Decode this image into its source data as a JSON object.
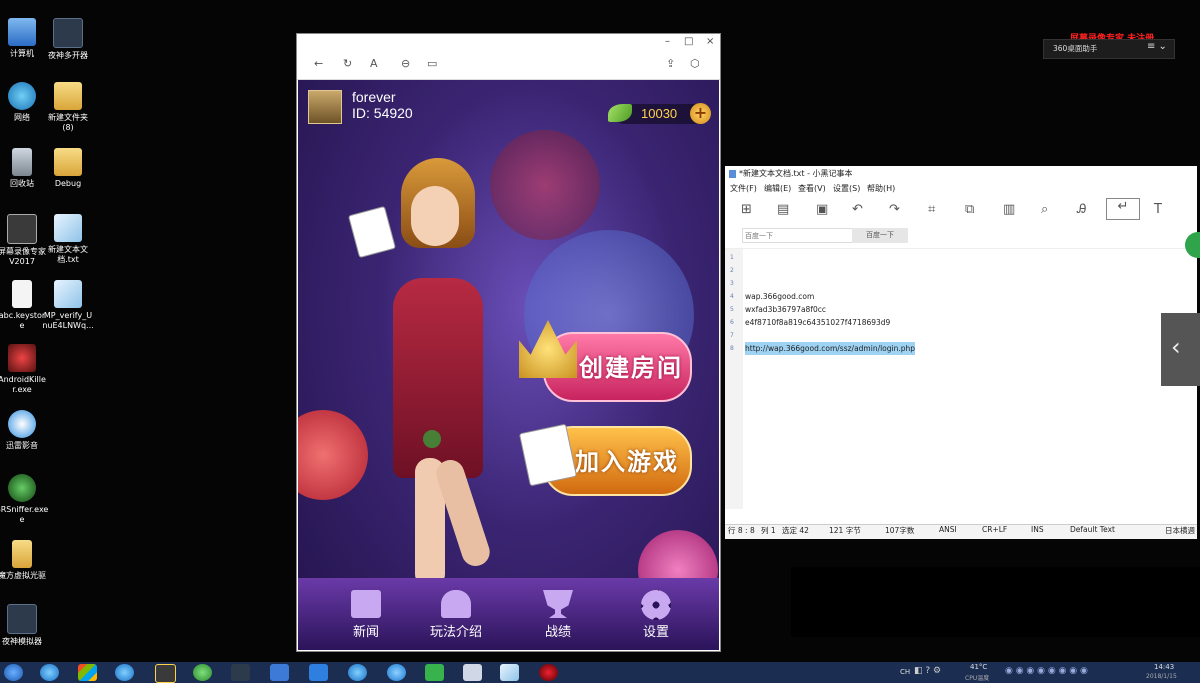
{
  "desktop": {
    "icons": [
      {
        "label": "计算机"
      },
      {
        "label": "夜神多开器"
      },
      {
        "label": "网络"
      },
      {
        "label": "新建文件夹\n(8)"
      },
      {
        "label": "回收站"
      },
      {
        "label": "Debug"
      },
      {
        "label": "屏幕录像专家\nV2017"
      },
      {
        "label": "新建文本文\n档.txt"
      },
      {
        "label": "abc.keystor\ne"
      },
      {
        "label": "MP_verify_U\nnuE4LNWq..."
      },
      {
        "label": "AndroidKille\nr.exe"
      },
      {
        "label": "迅雷影音"
      },
      {
        "label": "SRSniffer.exe\ne"
      },
      {
        "label": "魔方虚拟光驱"
      },
      {
        "label": "夜神模拟器"
      }
    ],
    "watermark": "屏幕录像专家 未注册",
    "assistant_label": "360桌面助手"
  },
  "browser": {
    "controls": {
      "minimize": "–",
      "maximize": "□",
      "close": "×"
    },
    "toolbar": {
      "back": "←",
      "refresh": "↻",
      "font": "A",
      "link": "⊖",
      "card": "▭",
      "share": "⇪",
      "cube": "⬡"
    }
  },
  "game": {
    "username": "forever",
    "user_id": "ID: 54920",
    "coins": "10030",
    "create_room": "创建房间",
    "join_game": "加入游戏",
    "nav": [
      {
        "label": "新闻",
        "icon": "calendar-icon"
      },
      {
        "label": "玩法介绍",
        "icon": "help-person-icon"
      },
      {
        "label": "战绩",
        "icon": "trophy-icon"
      },
      {
        "label": "设置",
        "icon": "gear-icon"
      }
    ]
  },
  "notepad": {
    "title": "*新建文本文档.txt - 小黑记事本",
    "menu": [
      "文件(F)",
      "编辑(E)",
      "查看(V)",
      "设置(S)",
      "帮助(H)"
    ],
    "search_placeholder": "百度一下",
    "search_button": "百度一下",
    "lines": [
      {
        "n": "1",
        "text": ""
      },
      {
        "n": "2",
        "text": ""
      },
      {
        "n": "3",
        "text": ""
      },
      {
        "n": "4",
        "text": "wap.366good.com"
      },
      {
        "n": "5",
        "text": "wxfad3b36797a8f0cc"
      },
      {
        "n": "6",
        "text": "e4f8710f8a819c64351027f4718693d9"
      },
      {
        "n": "7",
        "text": ""
      },
      {
        "n": "8",
        "text": "http://wap.366good.com/ssz/admin/login.php"
      }
    ],
    "status": {
      "pos": "行 8 : 8",
      "col": "列 1",
      "sel": "选定 42",
      "bytes": "121 字节",
      "chars": "107字数",
      "enc": "ANSI",
      "eol": "CR+LF",
      "ins": "INS",
      "font": "Default Text",
      "mode": "日本横週"
    }
  },
  "taskbar": {
    "temp": "41°C",
    "cpu": "CPU温度",
    "time": "14:43",
    "date": "2018/1/15",
    "ime": "CH"
  }
}
